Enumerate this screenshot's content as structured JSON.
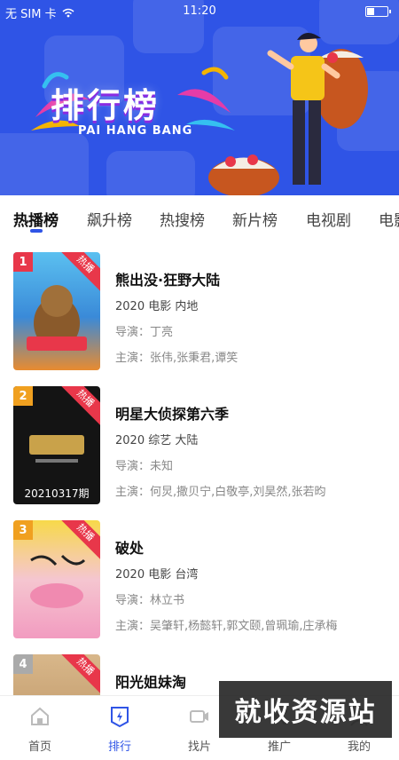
{
  "status_bar": {
    "carrier": "无 SIM 卡",
    "time": "11:20"
  },
  "banner": {
    "title": "排行榜",
    "subtitle": "PAI HANG BANG"
  },
  "tabs": [
    {
      "label": "热播榜",
      "active": true
    },
    {
      "label": "飙升榜",
      "active": false
    },
    {
      "label": "热搜榜",
      "active": false
    },
    {
      "label": "新片榜",
      "active": false
    },
    {
      "label": "电视剧",
      "active": false
    },
    {
      "label": "电影",
      "active": false
    }
  ],
  "hot_badge": "热播",
  "list": [
    {
      "rank": "1",
      "title": "熊出没·狂野大陆",
      "meta": "2020  电影  内地",
      "director": "导演：丁亮",
      "cast": "主演：张伟,张秉君,谭笑",
      "poster_color": "#3aa0d8",
      "rank_color": "#e8374a",
      "episode": ""
    },
    {
      "rank": "2",
      "title": "明星大侦探第六季",
      "meta": "2020  综艺  大陆",
      "director": "导演：未知",
      "cast": "主演：何炅,撒贝宁,白敬亭,刘昊然,张若昀",
      "poster_color": "#1a1a1a",
      "rank_color": "#f0a020",
      "episode": "20210317期"
    },
    {
      "rank": "3",
      "title": "破处",
      "meta": "2020  电影  台湾",
      "director": "导演：林立书",
      "cast": "主演：吴肇轩,杨懿轩,郭文颐,曾珮瑜,庄承梅",
      "poster_color": "#f5d33a",
      "rank_color": "#f0a020",
      "episode": ""
    },
    {
      "rank": "4",
      "title": "阳光姐妹淘",
      "meta": "",
      "director": "",
      "cast": "",
      "poster_color": "#c9a070",
      "rank_color": "#aaaaaa",
      "episode": ""
    }
  ],
  "bottom_nav": [
    {
      "label": "首页",
      "icon": "home-icon",
      "active": false
    },
    {
      "label": "排行",
      "icon": "ranking-icon",
      "active": true
    },
    {
      "label": "找片",
      "icon": "video-camera-icon",
      "active": false
    },
    {
      "label": "推广",
      "icon": "share-icon",
      "active": false
    },
    {
      "label": "我的",
      "icon": "profile-icon",
      "active": false
    }
  ],
  "watermark": "就收资源站",
  "colors": {
    "accent": "#2f54e6",
    "hot": "#e8374a"
  }
}
